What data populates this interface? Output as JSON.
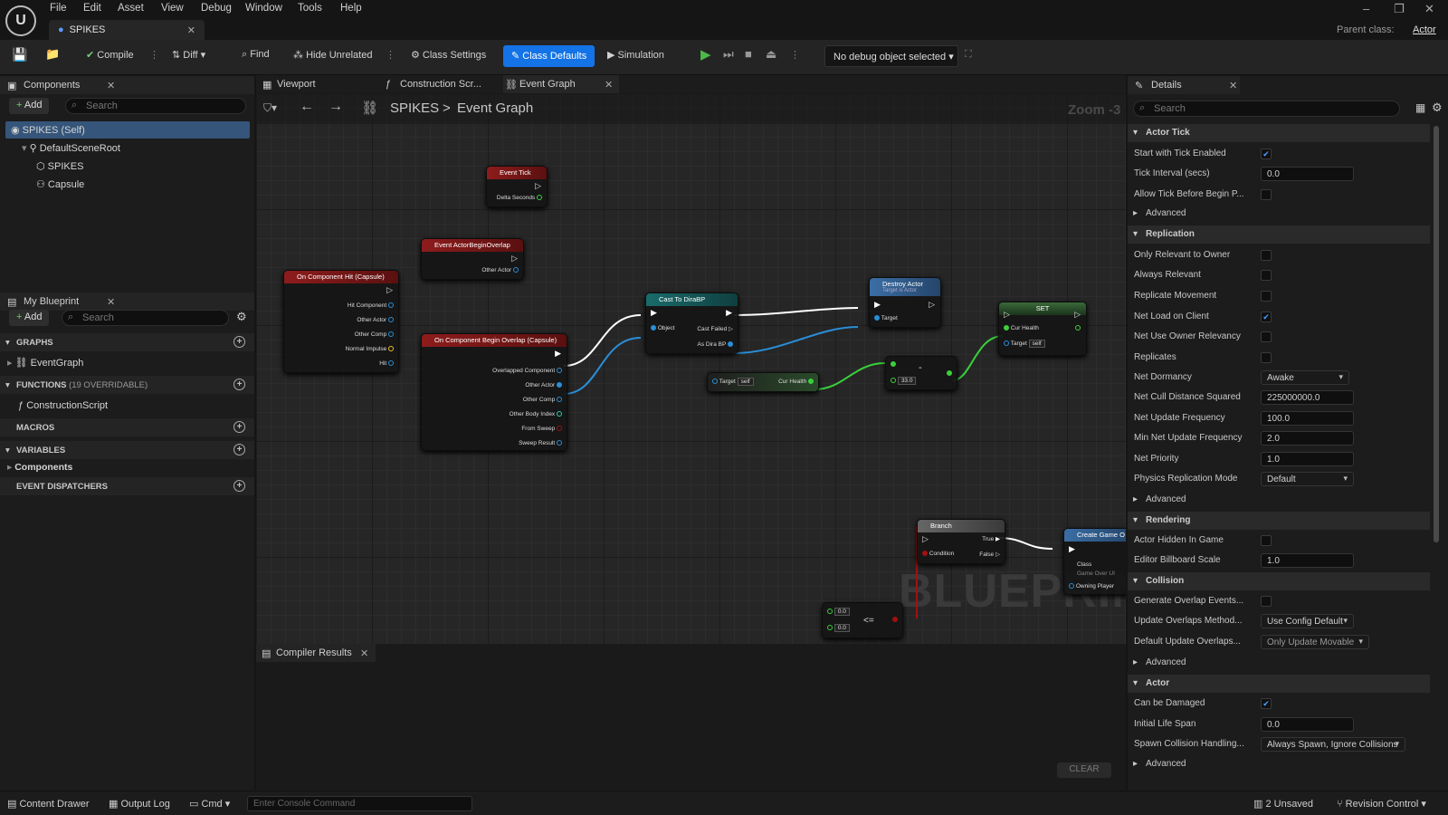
{
  "menu": [
    "File",
    "Edit",
    "Asset",
    "View",
    "Debug",
    "Window",
    "Tools",
    "Help"
  ],
  "doc_tab": "SPIKES",
  "parent_class": {
    "label": "Parent class:",
    "value": "Actor"
  },
  "toolbar": {
    "compile": "Compile",
    "diff": "Diff",
    "find": "Find",
    "hide_unrelated": "Hide Unrelated",
    "class_settings": "Class Settings",
    "class_defaults": "Class Defaults",
    "simulation": "Simulation",
    "debug_object": "No debug object selected"
  },
  "components": {
    "title": "Components",
    "add": "Add",
    "search": "Search",
    "tree": [
      "SPIKES (Self)",
      "DefaultSceneRoot",
      "SPIKES",
      "Capsule"
    ]
  },
  "my_blueprint": {
    "title": "My Blueprint",
    "add": "Add",
    "search": "Search",
    "graphs": "GRAPHS",
    "event_graph": "EventGraph",
    "functions": "FUNCTIONS",
    "functions_note": "(19 OVERRIDABLE)",
    "construction_script": "ConstructionScript",
    "macros": "MACROS",
    "variables": "VARIABLES",
    "components_cat": "Components",
    "event_dispatchers": "EVENT DISPATCHERS"
  },
  "graph_tabs": [
    "Viewport",
    "Construction Scr...",
    "Event Graph"
  ],
  "breadcrumb": {
    "root": "SPIKES",
    "sep": ">",
    "current": "Event Graph"
  },
  "zoom": "Zoom -3",
  "watermark": "BLUEPRINT",
  "nodes": {
    "event_tick": {
      "title": "Event Tick",
      "pins": [
        "Delta Seconds"
      ]
    },
    "actor_begin_overlap": {
      "title": "Event ActorBeginOverlap",
      "pins": [
        "Other Actor"
      ]
    },
    "component_hit": {
      "title": "On Component Hit (Capsule)",
      "pins": [
        "Hit Component",
        "Other Actor",
        "Other Comp",
        "Normal Impulse",
        "Hit"
      ]
    },
    "begin_overlap": {
      "title": "On Component Begin Overlap (Capsule)",
      "pins": [
        "Overlapped Component",
        "Other Actor",
        "Other Comp",
        "Other Body Index",
        "From Sweep",
        "Sweep Result"
      ]
    },
    "cast": {
      "title": "Cast To DiraBP",
      "pins": [
        "Object",
        "Cast Failed",
        "As Dira BP"
      ]
    },
    "destroy": {
      "title": "Destroy Actor",
      "subtitle": "Target is Actor",
      "pins": [
        "Target"
      ]
    },
    "set": {
      "title": "SET",
      "pins": [
        "Cur Health",
        "Target"
      ],
      "target_val": "self"
    },
    "get_health": {
      "target": "Target",
      "target_val": "self",
      "out": "Cur Health"
    },
    "subtract": {
      "symbol": "-",
      "value": "33.0"
    },
    "branch": {
      "title": "Branch",
      "pins": [
        "Condition",
        "True",
        "False"
      ]
    },
    "create": {
      "title": "Create Game O",
      "pins": [
        "Class",
        "Game Over UI",
        "Owning Player"
      ]
    },
    "compare": {
      "symbol": "<=",
      "a": "0.0",
      "b": "0.0"
    }
  },
  "compiler": {
    "title": "Compiler Results",
    "clear": "CLEAR"
  },
  "details": {
    "title": "Details",
    "search": "Search",
    "advanced": "Advanced",
    "sections": {
      "actor_tick": "Actor Tick",
      "replication": "Replication",
      "rendering": "Rendering",
      "collision": "Collision",
      "actor": "Actor"
    },
    "rows": [
      {
        "label": "Start with Tick Enabled",
        "type": "check",
        "value": true
      },
      {
        "label": "Tick Interval (secs)",
        "type": "input",
        "value": "0.0"
      },
      {
        "label": "Allow Tick Before Begin P...",
        "type": "check",
        "value": false
      },
      {
        "label": "Only Relevant to Owner",
        "type": "check",
        "value": false
      },
      {
        "label": "Always Relevant",
        "type": "check",
        "value": false
      },
      {
        "label": "Replicate Movement",
        "type": "check",
        "value": false
      },
      {
        "label": "Net Load on Client",
        "type": "check",
        "value": true
      },
      {
        "label": "Net Use Owner Relevancy",
        "type": "check",
        "value": false
      },
      {
        "label": "Replicates",
        "type": "check",
        "value": false
      },
      {
        "label": "Net Dormancy",
        "type": "dropdown",
        "value": "Awake"
      },
      {
        "label": "Net Cull Distance Squared",
        "type": "input",
        "value": "225000000.0"
      },
      {
        "label": "Net Update Frequency",
        "type": "input",
        "value": "100.0"
      },
      {
        "label": "Min Net Update Frequency",
        "type": "input",
        "value": "2.0"
      },
      {
        "label": "Net Priority",
        "type": "input",
        "value": "1.0"
      },
      {
        "label": "Physics Replication Mode",
        "type": "dropdown",
        "value": "Default"
      },
      {
        "label": "Actor Hidden In Game",
        "type": "check",
        "value": false
      },
      {
        "label": "Editor Billboard Scale",
        "type": "input",
        "value": "1.0"
      },
      {
        "label": "Generate Overlap Events...",
        "type": "check",
        "value": false
      },
      {
        "label": "Update Overlaps Method...",
        "type": "dropdown",
        "value": "Use Config Default"
      },
      {
        "label": "Default Update Overlaps...",
        "type": "dropdown",
        "value": "Only Update Movable"
      },
      {
        "label": "Can be Damaged",
        "type": "check",
        "value": true
      },
      {
        "label": "Initial Life Span",
        "type": "input",
        "value": "0.0"
      },
      {
        "label": "Spawn Collision Handling...",
        "type": "dropdown",
        "value": "Always Spawn, Ignore Collisions"
      }
    ]
  },
  "statusbar": {
    "content_drawer": "Content Drawer",
    "output_log": "Output Log",
    "cmd": "Cmd",
    "console_placeholder": "Enter Console Command",
    "unsaved": "2 Unsaved",
    "revision_control": "Revision Control"
  }
}
